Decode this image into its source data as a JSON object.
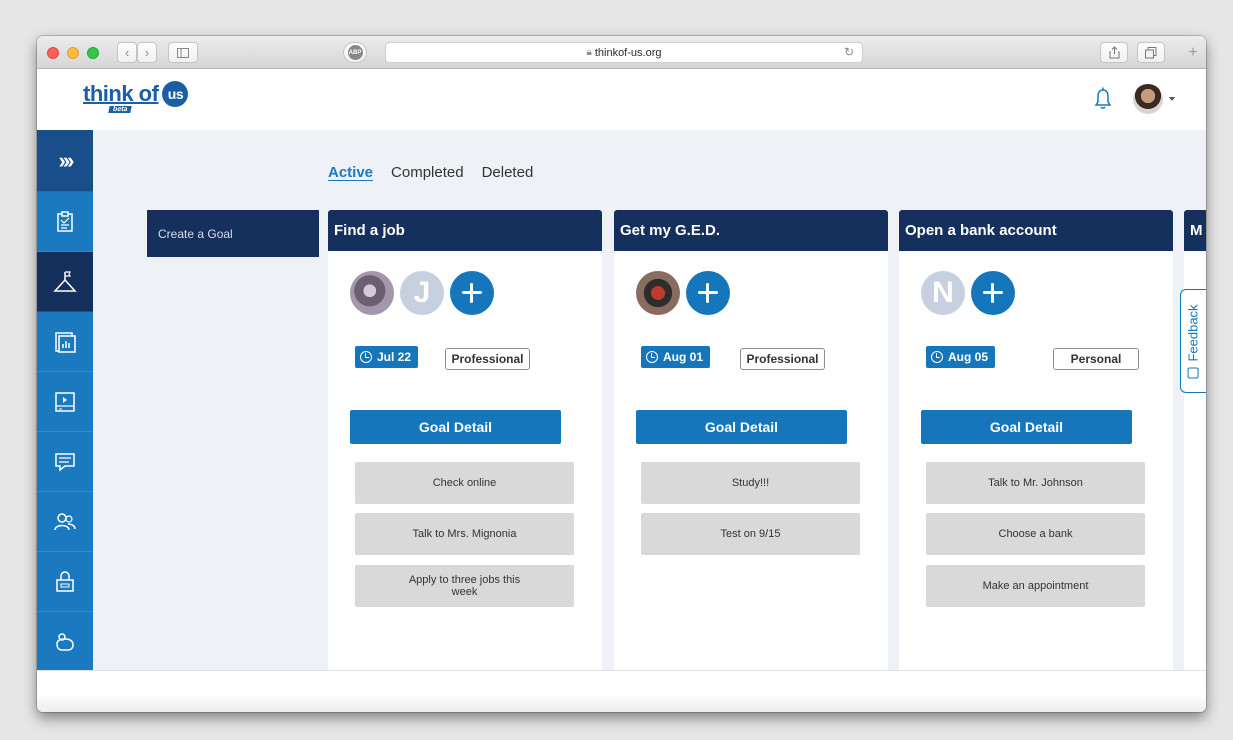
{
  "browser": {
    "url": "thinkof-us.org",
    "adblock_label": "ABP"
  },
  "header": {
    "logo_text": "think of",
    "logo_circle": "us",
    "logo_tag": "beta"
  },
  "sidebar": {
    "items": [
      {
        "name": "expand",
        "icon": "double-chevron-right-icon"
      },
      {
        "name": "checklist",
        "icon": "clipboard-icon"
      },
      {
        "name": "goals",
        "icon": "mountain-flag-icon"
      },
      {
        "name": "reports",
        "icon": "chart-document-icon"
      },
      {
        "name": "media",
        "icon": "video-icon"
      },
      {
        "name": "messages",
        "icon": "chat-icon"
      },
      {
        "name": "people",
        "icon": "people-icon"
      },
      {
        "name": "security",
        "icon": "lock-icon"
      },
      {
        "name": "savings",
        "icon": "piggy-bank-icon"
      }
    ]
  },
  "tabs": [
    {
      "label": "Active",
      "active": true
    },
    {
      "label": "Completed",
      "active": false
    },
    {
      "label": "Deleted",
      "active": false
    }
  ],
  "create_goal_label": "Create a Goal",
  "goals": [
    {
      "title": "Find a job",
      "members": [
        {
          "type": "photo"
        },
        {
          "type": "letter",
          "letter": "J"
        }
      ],
      "date": "Jul 22",
      "category": "Professional",
      "detail_label": "Goal Detail",
      "tasks": [
        "Check online",
        "Talk to Mrs. Mignonia",
        "Apply to three jobs this week"
      ]
    },
    {
      "title": "Get my G.E.D.",
      "members": [
        {
          "type": "photo"
        }
      ],
      "date": "Aug 01",
      "category": "Professional",
      "detail_label": "Goal Detail",
      "tasks": [
        "Study!!!",
        "Test on 9/15"
      ]
    },
    {
      "title": "Open a bank account",
      "members": [
        {
          "type": "letter",
          "letter": "N"
        }
      ],
      "date": "Aug 05",
      "category": "Personal",
      "detail_label": "Goal Detail",
      "tasks": [
        "Talk to Mr. Johnson",
        "Choose a bank",
        "Make an appointment"
      ]
    },
    {
      "title": "M",
      "partial": true
    }
  ],
  "feedback_label": "Feedback",
  "colors": {
    "navy": "#16305e",
    "blue": "#1576bc",
    "sidebar": "#1b79bf",
    "task_gray": "#d9d9d9"
  }
}
